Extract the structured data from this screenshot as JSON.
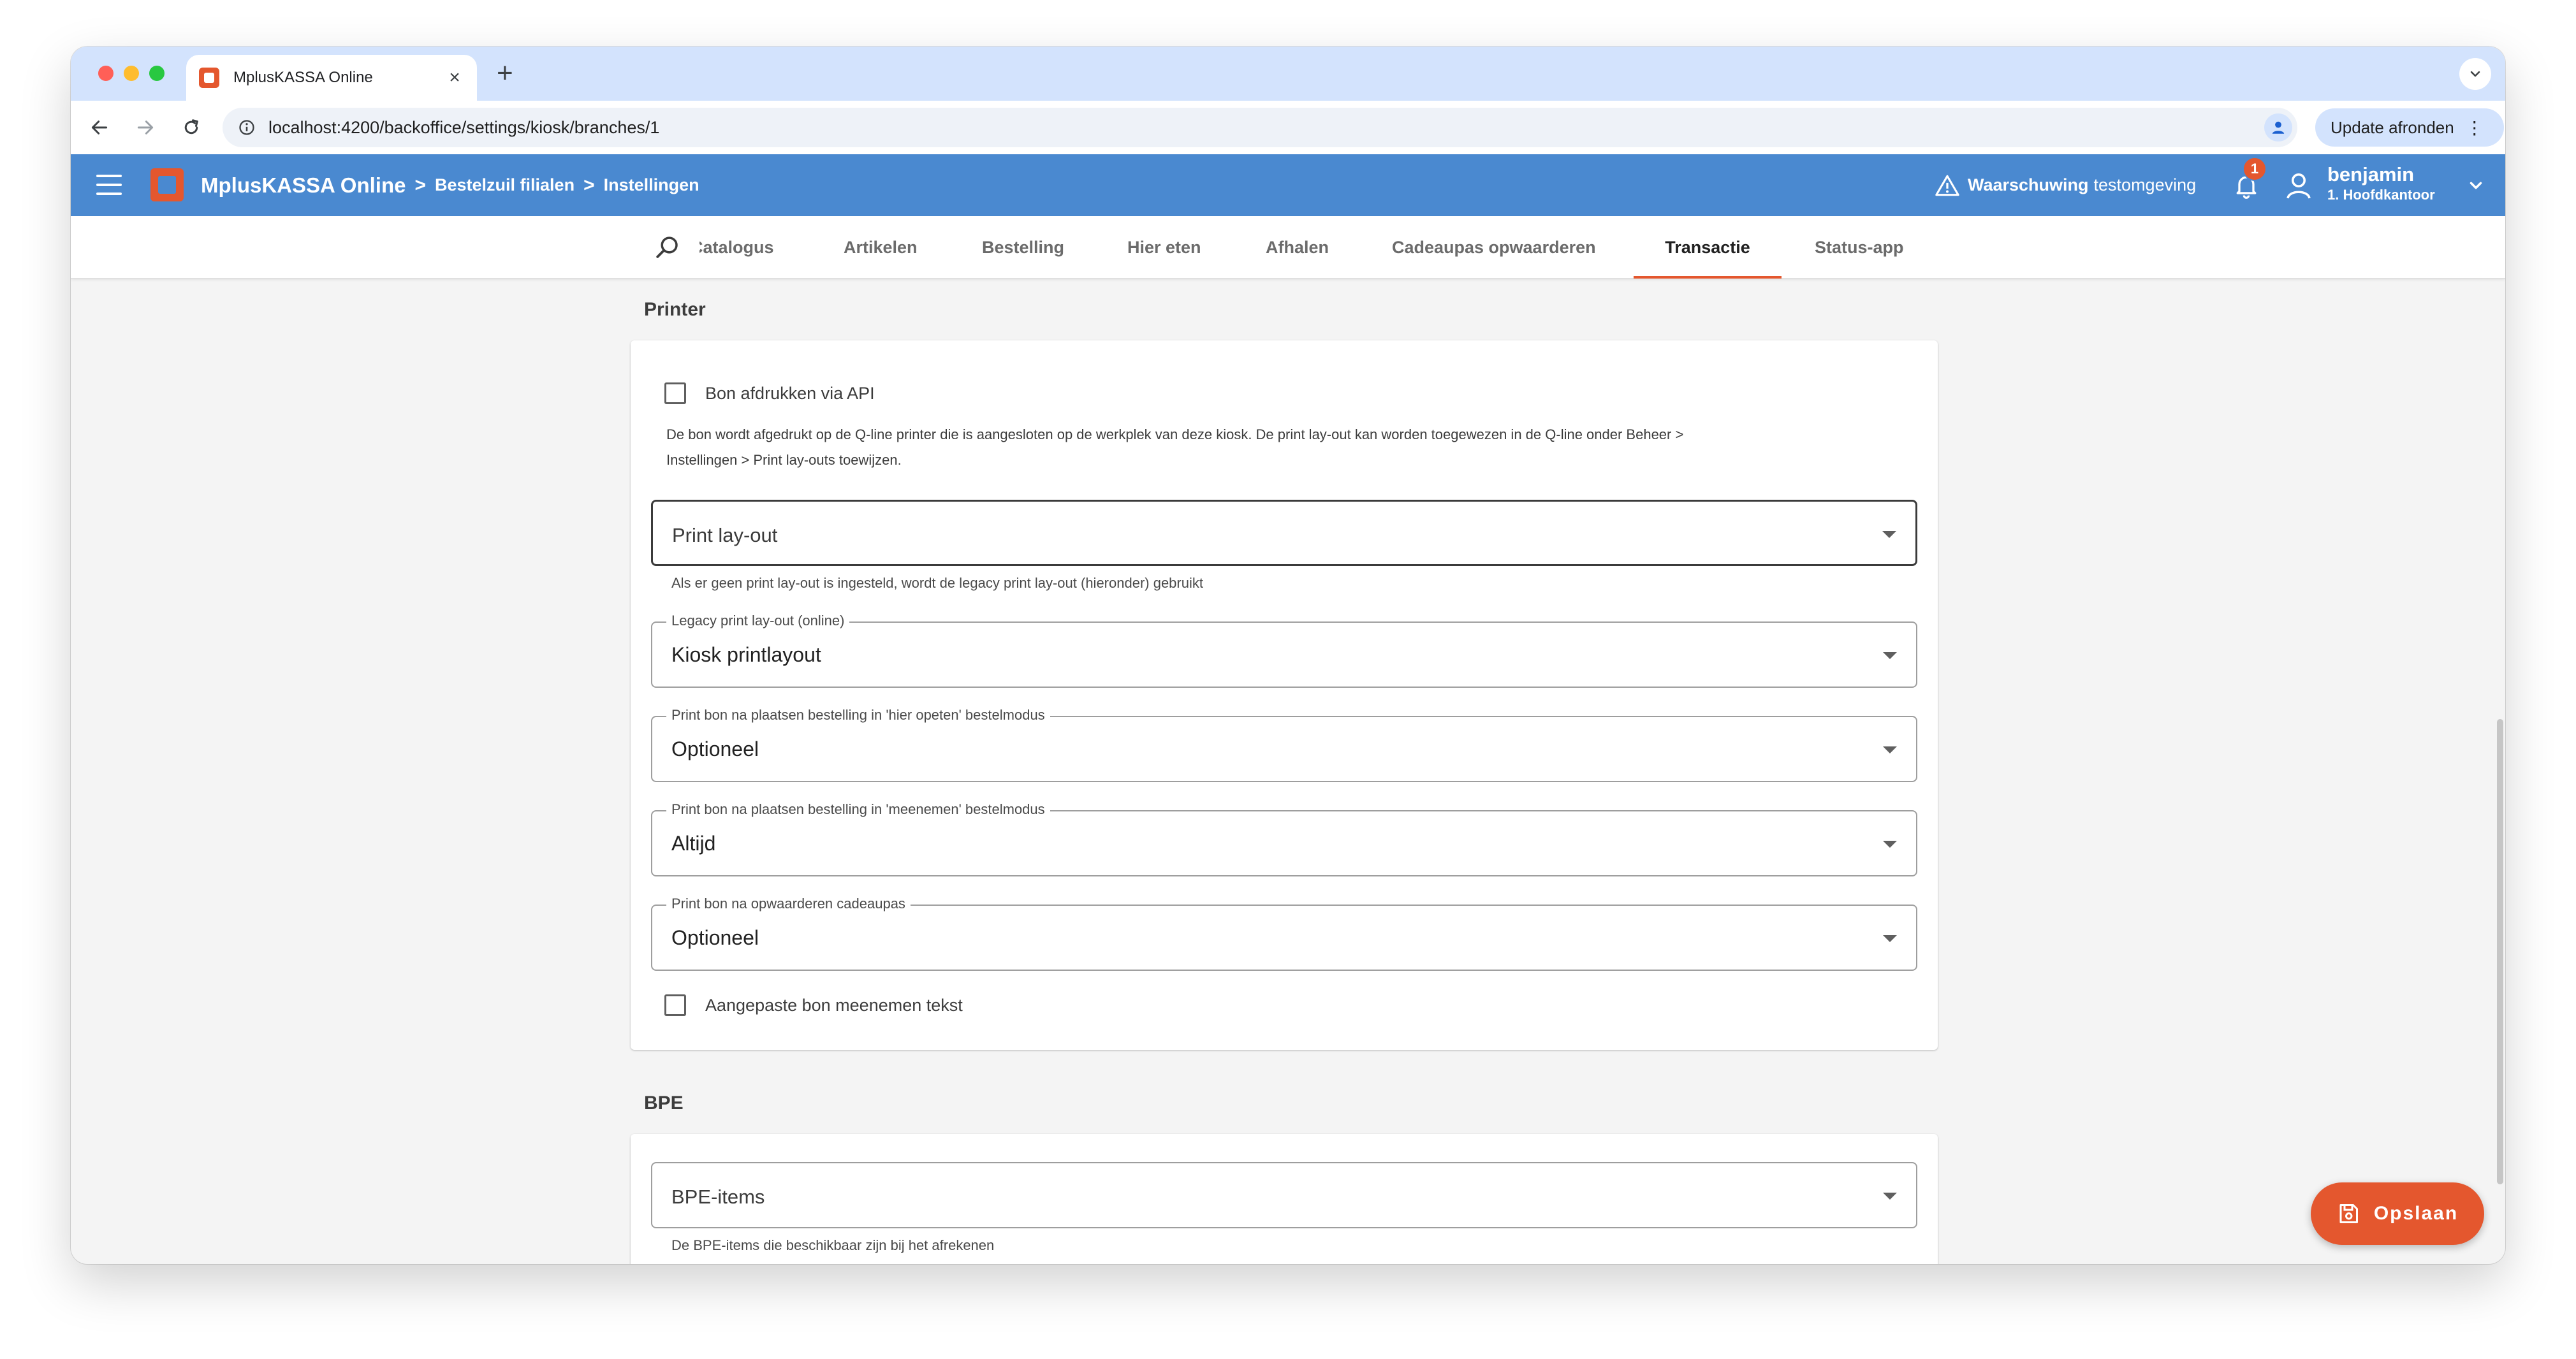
{
  "browser": {
    "tab_title": "MplusKASSA Online",
    "tab_close": "×",
    "new_tab": "+",
    "url": "localhost:4200/backoffice/settings/kiosk/branches/1",
    "update_button": "Update afronden",
    "update_menu": "⋮"
  },
  "header": {
    "app_name": "MplusKASSA Online",
    "separator": ">",
    "breadcrumbs": [
      "Bestelzuil filialen",
      "Instellingen"
    ],
    "warning_bold": "Waarschuwing",
    "warning_text": "testomgeving",
    "notification_count": "1",
    "user_name": "benjamin",
    "user_branch": "1. Hoofdkantoor"
  },
  "tabs": {
    "items": [
      "Catalogus",
      "Artikelen",
      "Bestelling",
      "Hier eten",
      "Afhalen",
      "Cadeaupas opwaarderen",
      "Transactie",
      "Status-app"
    ],
    "active": "Transactie"
  },
  "printer": {
    "section_title": "Printer",
    "api_print_label": "Bon afdrukken via API",
    "api_print_checked": false,
    "api_help_line1": "De bon wordt afgedrukt op de Q-line printer die is aangesloten op de werkplek van deze kiosk. De print lay-out kan worden toegewezen in de Q-line onder Beheer >",
    "api_help_line2": "Instellingen > Print lay-outs toewijzen.",
    "print_layout_placeholder": "Print lay-out",
    "print_layout_hint": "Als er geen print lay-out is ingesteld, wordt de legacy print lay-out (hieronder) gebruikt",
    "legacy_layout_label": "Legacy print lay-out (online)",
    "legacy_layout_value": "Kiosk printlayout",
    "eat_in_label": "Print bon na plaatsen bestelling in 'hier opeten' bestelmodus",
    "eat_in_value": "Optioneel",
    "takeaway_label": "Print bon na plaatsen bestelling in 'meenemen' bestelmodus",
    "takeaway_value": "Altijd",
    "giftcard_label": "Print bon na opwaarderen cadeaupas",
    "giftcard_value": "Optioneel",
    "custom_takeaway_label": "Aangepaste bon meenemen tekst",
    "custom_takeaway_checked": false
  },
  "bpe": {
    "section_title": "BPE",
    "items_placeholder": "BPE-items",
    "items_hint": "De BPE-items die beschikbaar zijn bij het afrekenen"
  },
  "fab": {
    "label": "Opslaan"
  },
  "colors": {
    "brand_blue": "#4a89d0",
    "accent_orange": "#e4572e",
    "browser_chrome": "#d3e3fd"
  }
}
